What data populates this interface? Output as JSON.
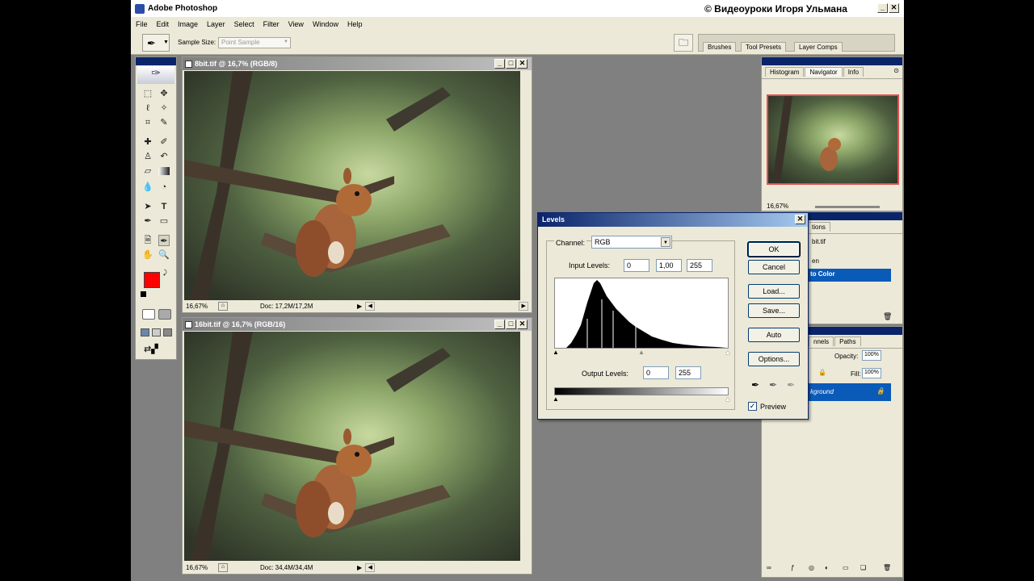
{
  "titlebar": {
    "app_title": "Adobe Photoshop",
    "watermark": "© Видеоуроки Игоря Ульмана"
  },
  "menu": [
    "File",
    "Edit",
    "Image",
    "Layer",
    "Select",
    "Filter",
    "View",
    "Window",
    "Help"
  ],
  "options": {
    "sample_size_label": "Sample Size:",
    "sample_size_value": "Point Sample"
  },
  "palette_well": [
    "Brushes",
    "Tool Presets",
    "Layer Comps"
  ],
  "doc1": {
    "title": "8bit.tif @ 16,7% (RGB/8)",
    "zoom": "16,67%",
    "doc_size": "Doc: 17,2M/17,2M"
  },
  "doc2": {
    "title": "16bit.tif @ 16,7% (RGB/16)",
    "zoom": "16,67%",
    "doc_size": "Doc: 34,4M/34,4M"
  },
  "navigator": {
    "tabs": [
      "Histogram",
      "Navigator",
      "Info"
    ],
    "zoom": "16,67%"
  },
  "history": {
    "tab_partial": "tions",
    "snapshot_partial": "bit.tif",
    "item1_partial": "en",
    "item2_partial": "to Color"
  },
  "layers": {
    "tabs_partial": "nnels",
    "tab_paths": "Paths",
    "opacity_label": "Opacity:",
    "opacity_value": "100%",
    "fill_label": "Fill:",
    "fill_value": "100%",
    "layer_name_partial": "kground"
  },
  "levels": {
    "title": "Levels",
    "channel_label": "Channel:",
    "channel_value": "RGB",
    "input_label": "Input Levels:",
    "input_black": "0",
    "input_gamma": "1,00",
    "input_white": "255",
    "output_label": "Output Levels:",
    "output_black": "0",
    "output_white": "255",
    "buttons": {
      "ok": "OK",
      "cancel": "Cancel",
      "load": "Load...",
      "save": "Save...",
      "auto": "Auto",
      "options": "Options..."
    },
    "preview_label": "Preview",
    "preview_checked": true
  },
  "colors": {
    "foreground": "#ff0000",
    "background": "#ffffff",
    "title_active": "#0a246a",
    "face": "#ece9d8"
  }
}
